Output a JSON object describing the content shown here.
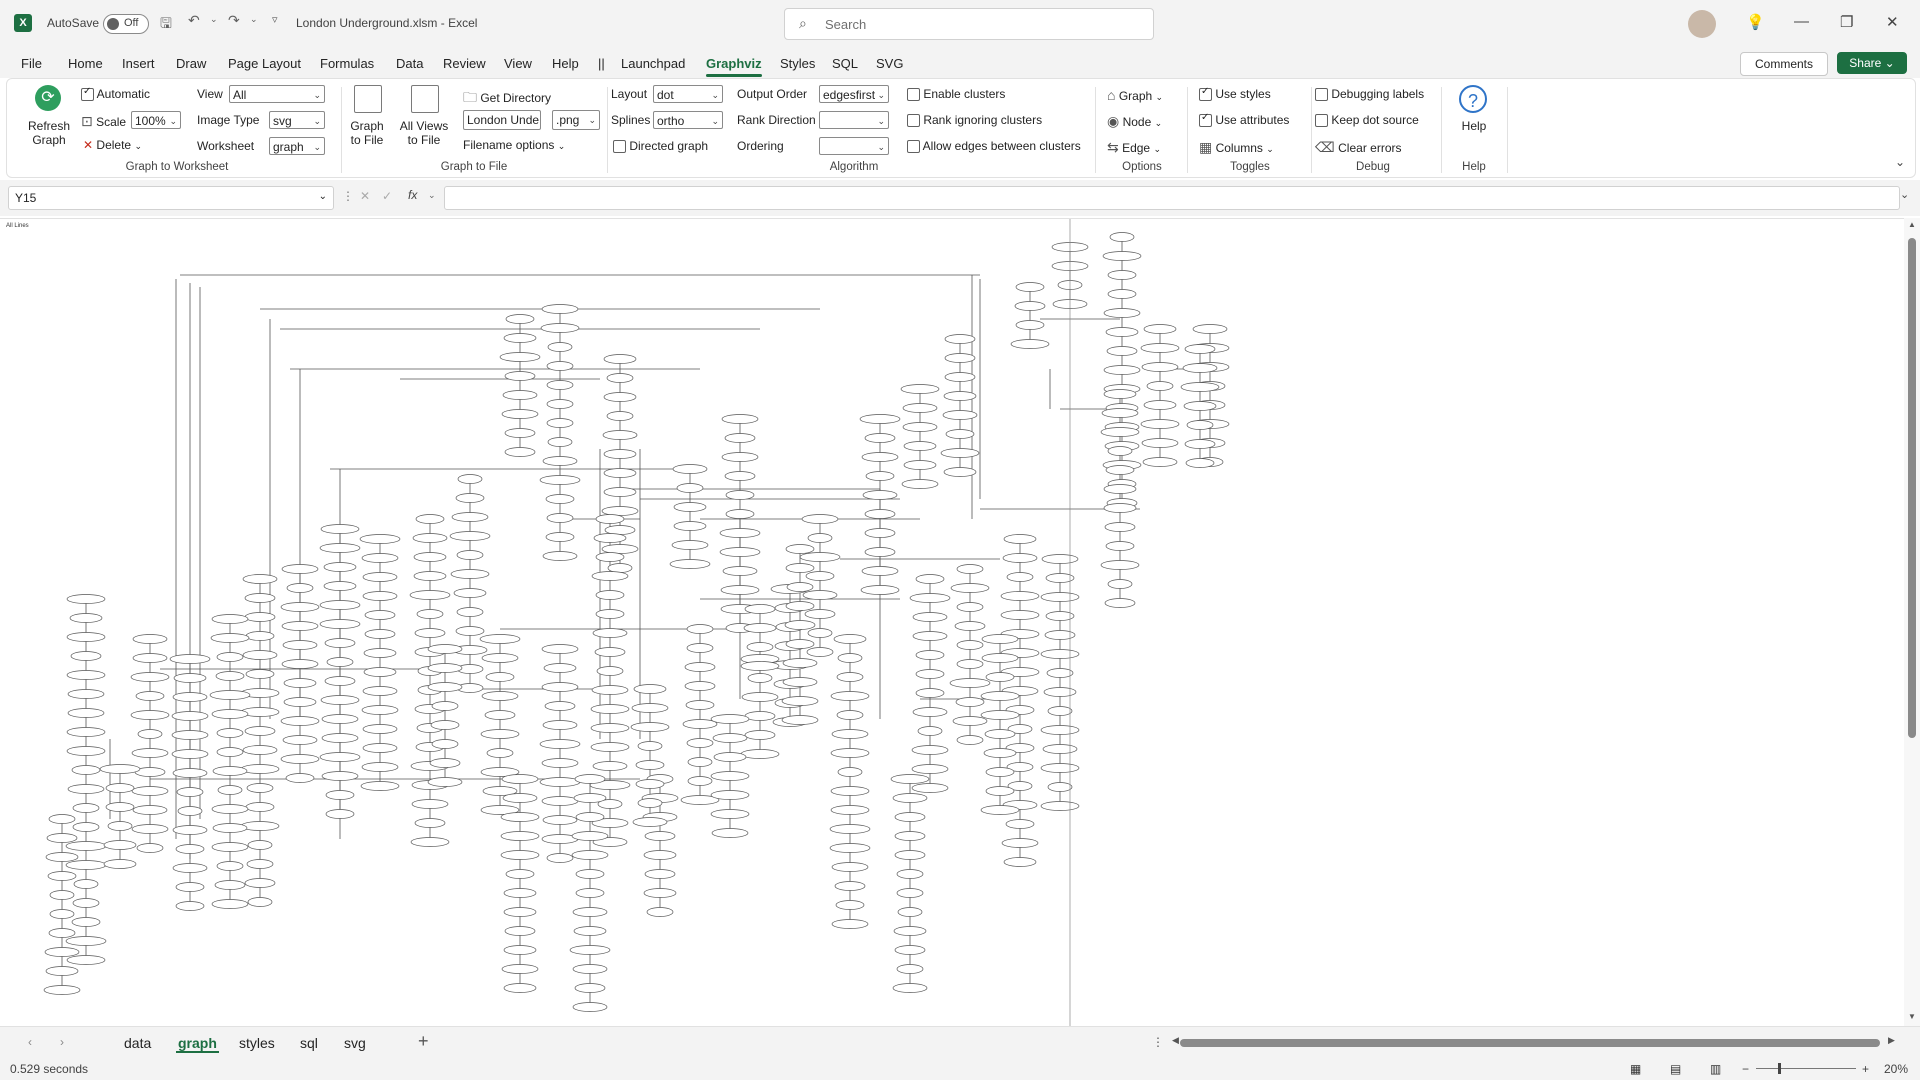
{
  "titlebar": {
    "autosave_label": "AutoSave",
    "autosave_state": "Off",
    "title": "London Underground.xlsm  -  Excel",
    "search_placeholder": "Search"
  },
  "menu": [
    "File",
    "Home",
    "Insert",
    "Draw",
    "Page Layout",
    "Formulas",
    "Data",
    "Review",
    "View",
    "Help",
    "||",
    "Launchpad",
    "Graphviz",
    "Styles",
    "SQL",
    "SVG"
  ],
  "menu_active": "Graphviz",
  "actions": {
    "comments": "Comments",
    "share": "Share"
  },
  "ribbon": {
    "refresh_label": "Refresh Graph",
    "automatic": "Automatic",
    "scale_label": "Scale",
    "scale_value": "100%",
    "delete_label": "Delete",
    "view_label": "View",
    "view_value": "All",
    "image_type_label": "Image Type",
    "image_type_value": "svg",
    "worksheet_label": "Worksheet",
    "worksheet_value": "graph",
    "group_graph_to_worksheet": "Graph to Worksheet",
    "graph_to_file_label": "Graph to File",
    "all_views_label": "All Views to File",
    "get_directory": "Get Directory",
    "filename_value": "London Unde",
    "file_ext_value": ".png",
    "filename_options": "Filename options",
    "group_graph_to_file": "Graph to File",
    "layout_label": "Layout",
    "layout_value": "dot",
    "splines_label": "Splines",
    "splines_value": "ortho",
    "directed_graph": "Directed graph",
    "output_order_label": "Output Order",
    "output_order_value": "edgesfirst",
    "rank_direction_label": "Rank Direction",
    "rank_direction_value": "",
    "ordering_label": "Ordering",
    "ordering_value": "",
    "enable_clusters": "Enable clusters",
    "rank_ignoring_clusters": "Rank ignoring clusters",
    "allow_edges_between_clusters": "Allow edges between clusters",
    "group_algorithm": "Algorithm",
    "graph_menu": "Graph",
    "node_menu": "Node",
    "edge_menu": "Edge",
    "group_options": "Options",
    "use_styles": "Use styles",
    "use_attributes": "Use attributes",
    "columns": "Columns",
    "group_toggles": "Toggles",
    "debugging_labels": "Debugging labels",
    "keep_dot_source": "Keep dot source",
    "clear_errors": "Clear errors",
    "group_debug": "Debug",
    "help_label": "Help",
    "group_help": "Help"
  },
  "formula_bar": {
    "name_box": "Y15",
    "formula": ""
  },
  "sheet": {
    "graph_caption": "All Lines"
  },
  "tabs": [
    "data",
    "graph",
    "styles",
    "sql",
    "svg"
  ],
  "active_tab": "graph",
  "status": {
    "timing": "0.529 seconds",
    "zoom": "20%"
  }
}
